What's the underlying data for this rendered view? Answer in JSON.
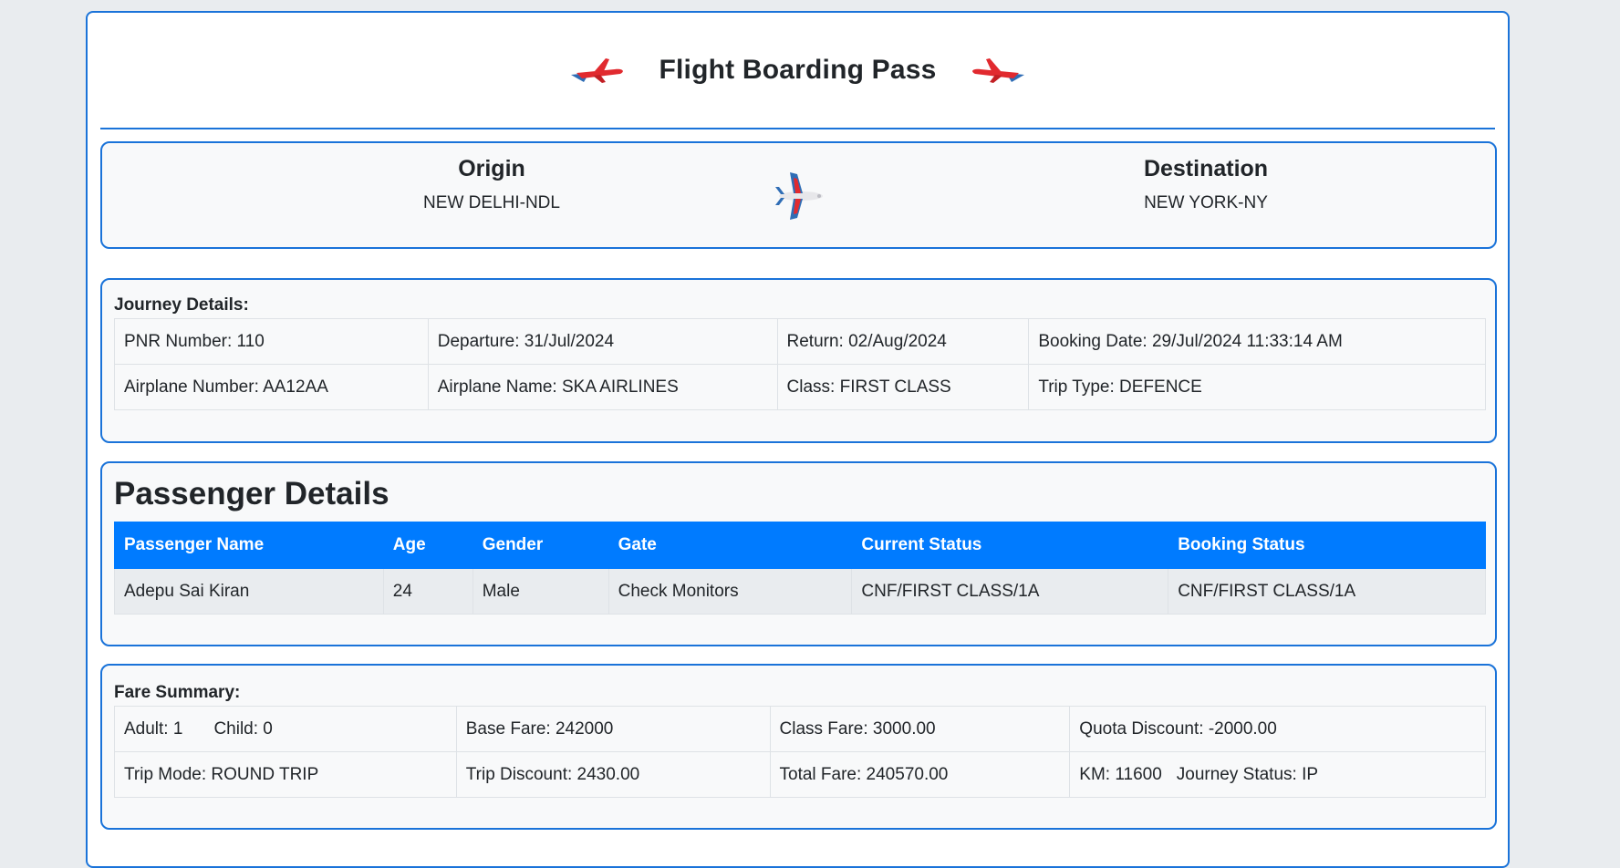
{
  "header": {
    "title": "Flight Boarding Pass"
  },
  "icons": {
    "left": "airplane-icon",
    "right": "airplane-icon",
    "route": "airplane-icon"
  },
  "colors": {
    "accent": "#1a73d9",
    "table_header": "#007bff",
    "plane_red": "#e12a2f",
    "plane_blue": "#2f6db5"
  },
  "route": {
    "origin_label": "Origin",
    "origin_value": "NEW DELHI-NDL",
    "destination_label": "Destination",
    "destination_value": "NEW YORK-NY"
  },
  "journey": {
    "label": "Journey Details:",
    "rows": [
      [
        "PNR Number: 110",
        "Departure: 31/Jul/2024",
        "Return: 02/Aug/2024",
        "Booking Date: 29/Jul/2024 11:33:14 AM"
      ],
      [
        "Airplane Number: AA12AA",
        "Airplane Name: SKA AIRLINES",
        "Class: FIRST CLASS",
        "Trip Type: DEFENCE"
      ]
    ]
  },
  "passengers": {
    "title": "Passenger Details",
    "columns": [
      "Passenger Name",
      "Age",
      "Gender",
      "Gate",
      "Current Status",
      "Booking Status"
    ],
    "rows": [
      [
        "Adepu Sai Kiran",
        "24",
        "Male",
        "Check Monitors",
        "CNF/FIRST CLASS/1A",
        "CNF/FIRST CLASS/1A"
      ]
    ]
  },
  "fare": {
    "label": "Fare Summary:",
    "adult": "Adult: 1",
    "child": "Child: 0",
    "base_fare": "Base Fare: 242000",
    "class_fare": "Class Fare: 3000.00",
    "quota_discount": "Quota Discount: -2000.00",
    "trip_mode": "Trip Mode: ROUND TRIP",
    "trip_discount": "Trip Discount: 2430.00",
    "total_fare": "Total Fare: 240570.00",
    "km": "KM: 11600",
    "journey_status": "Journey Status: IP"
  }
}
